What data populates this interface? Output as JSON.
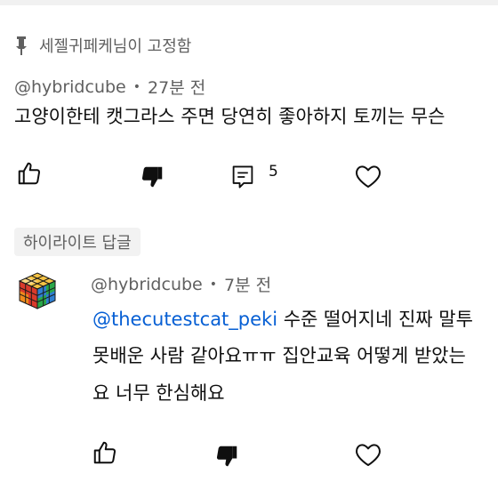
{
  "pinned": {
    "label": "세젤귀페케님이 고정함"
  },
  "comment": {
    "author": "@hybridcube",
    "separator": "•",
    "time": "27분 전",
    "text": "고양이한테 캣그라스 주면 당연히 좋아하지 토끼는 무슨",
    "reply_count": "5"
  },
  "highlight_chip": "하이라이트 답글",
  "reply": {
    "author": "@hybridcube",
    "separator": "•",
    "time": "7분 전",
    "mention": "@thecutestcat_peki",
    "line1_rest": " 수준 떨어지네 진짜 말투",
    "line2": "못배운 사람 같아요ㅠㅠ 집안교육 어떻게 받았는",
    "line3": "요 너무 한심해요"
  },
  "colors": {
    "secondary_text": "#606060",
    "link": "#065fd4",
    "chip_bg": "#f2f2f2"
  },
  "icons": [
    "pin-icon",
    "like-icon",
    "dislike-icon",
    "reply-icon",
    "heart-icon",
    "avatar-cube-icon"
  ]
}
